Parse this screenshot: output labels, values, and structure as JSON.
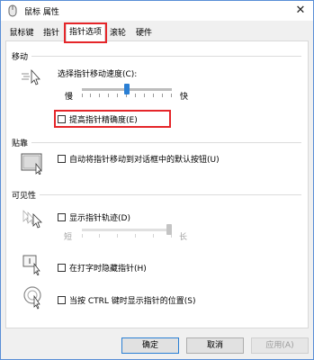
{
  "window": {
    "title": "鼠标 属性",
    "close_glyph": "✕"
  },
  "tabs": [
    {
      "label": "鼠标键"
    },
    {
      "label": "指针"
    },
    {
      "label": "指针选项",
      "active": true
    },
    {
      "label": "滚轮"
    },
    {
      "label": "硬件"
    }
  ],
  "motion": {
    "group": "移动",
    "speed_label": "选择指针移动速度(C):",
    "slow": "慢",
    "fast": "快",
    "speed_level": 0.5,
    "precision_label": "提高指针精确度(E)",
    "precision_checked": false
  },
  "snap": {
    "group": "贴靠",
    "label": "自动将指针移动到对话框中的默认按钮(U)",
    "checked": false
  },
  "visibility": {
    "group": "可见性",
    "trails_label": "显示指针轨迹(D)",
    "trails_checked": false,
    "short": "短",
    "long": "长",
    "trails_level": 1.0,
    "hide_label": "在打字时隐藏指针(H)",
    "hide_checked": false,
    "ctrl_label": "当按 CTRL 键时显示指针的位置(S)",
    "ctrl_checked": false
  },
  "buttons": {
    "ok": "确定",
    "cancel": "取消",
    "apply": "应用(A)"
  },
  "colors": {
    "highlight": "#e5262a",
    "accent": "#2a7fd4"
  }
}
